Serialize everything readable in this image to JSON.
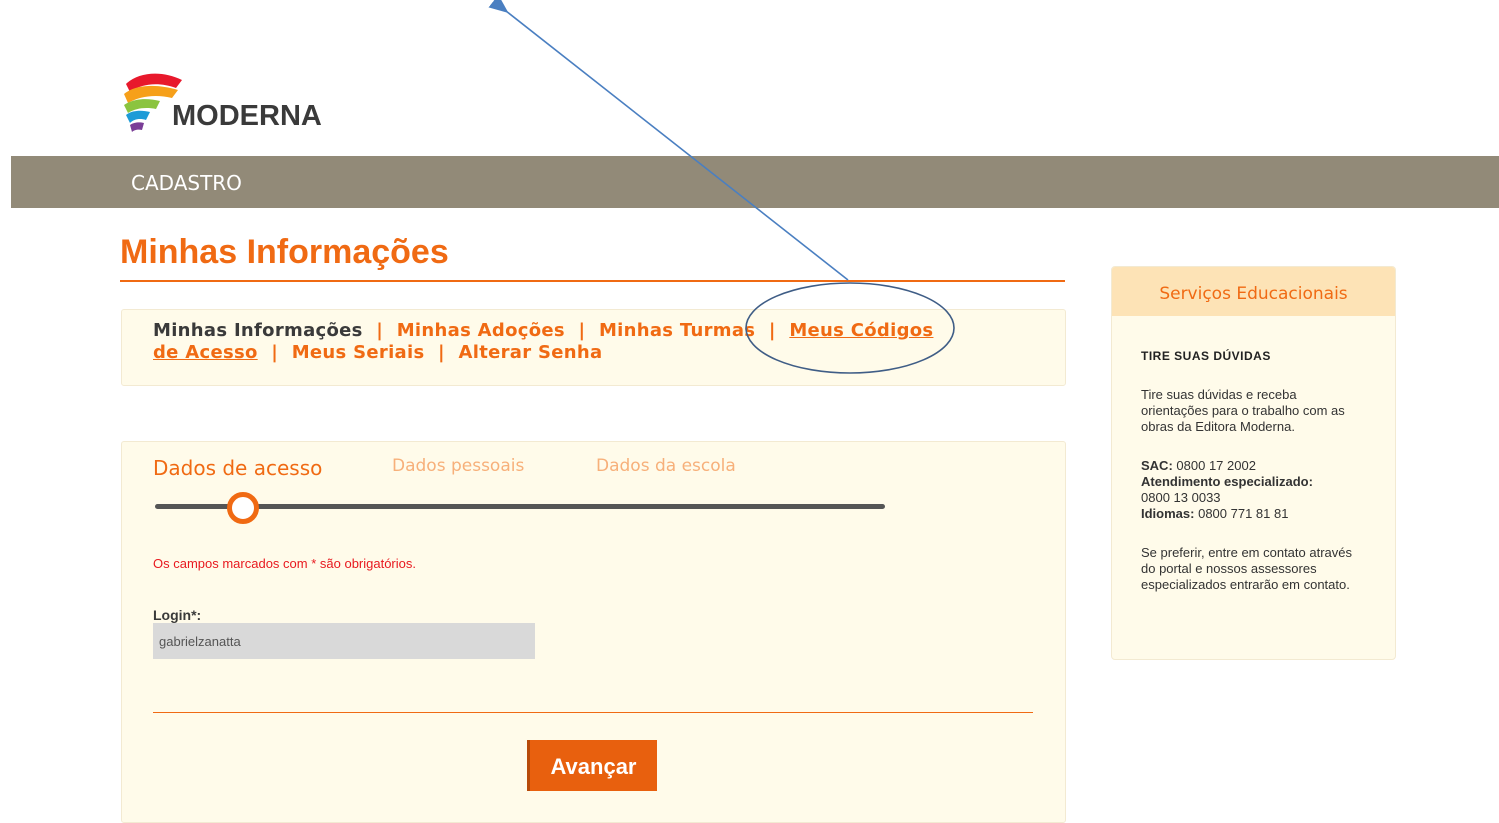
{
  "brand": {
    "name": "MODERNA"
  },
  "navbar": {
    "item": "CADASTRO"
  },
  "page": {
    "title": "Minhas Informações"
  },
  "subnav": {
    "items": [
      {
        "label": "Minhas Informações"
      },
      {
        "label": "Minhas Adoções"
      },
      {
        "label": "Minhas Turmas"
      },
      {
        "label": "Meus Códigos de Acesso"
      },
      {
        "label": "Meus Seriais"
      },
      {
        "label": "Alterar Senha"
      }
    ],
    "separator": "|"
  },
  "steps": [
    {
      "label": "Dados de acesso"
    },
    {
      "label": "Dados pessoais"
    },
    {
      "label": "Dados da escola"
    }
  ],
  "form": {
    "required_note": "Os campos marcados com * são obrigatórios.",
    "login_label": "Login*:",
    "login_value": "gabrielzanatta",
    "advance_button": "Avançar"
  },
  "sidebar": {
    "header": "Serviços Educacionais",
    "title": "TIRE SUAS DÚVIDAS",
    "intro": "Tire suas dúvidas e receba orientações para o trabalho com as obras da Editora Moderna.",
    "sac_label": "SAC:",
    "sac_value": "0800 17 2002",
    "atendimento_label": "Atendimento especializado:",
    "atendimento_value": "0800 13 0033",
    "idiomas_label": "Idiomas:",
    "idiomas_value": "0800 771 81 81",
    "outro": "Se preferir, entre em contato através do portal e nossos assessores especializados entrarão em contato."
  },
  "colors": {
    "accent": "#f06a13",
    "navbar": "#928a78",
    "panel": "#fffbea",
    "annotation": "#4a7fc1"
  }
}
